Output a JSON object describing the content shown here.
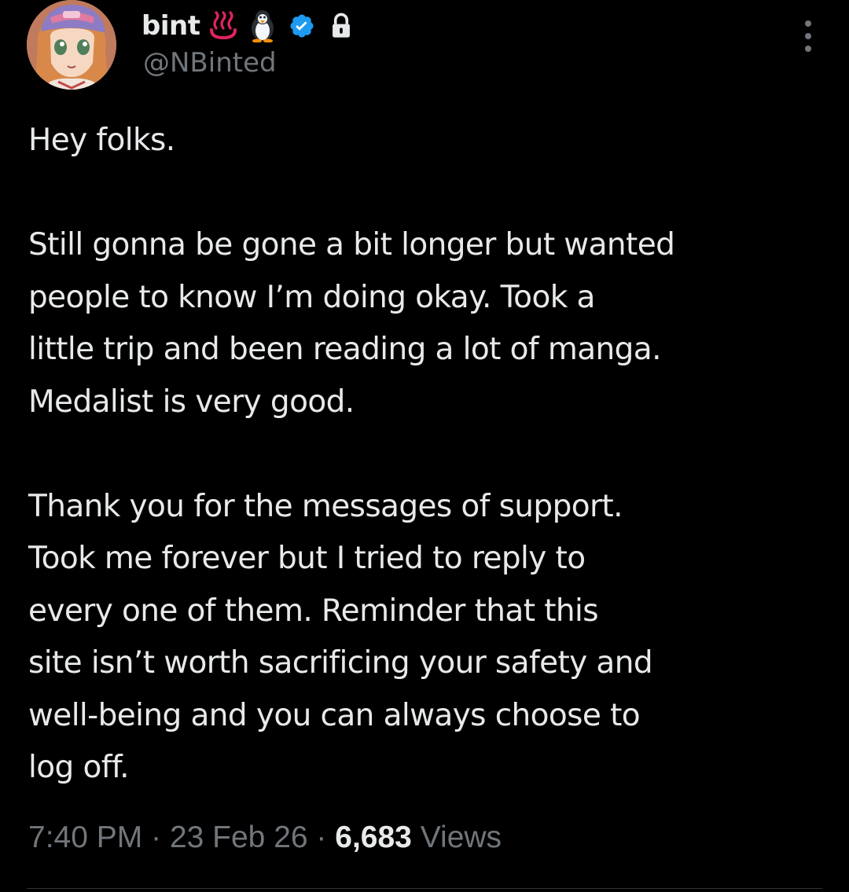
{
  "user": {
    "display_name": "bint",
    "handle": "@NBinted",
    "badges": [
      "hot-springs-icon",
      "penguin-icon",
      "verified-badge-icon",
      "lock-icon"
    ]
  },
  "tweet": {
    "paragraphs": [
      [
        "Hey folks."
      ],
      [
        "Still gonna be gone a bit longer but wanted",
        "people to know I’m doing okay. Took a",
        "little trip and been reading a lot of manga.",
        "Medalist is very good."
      ],
      [
        "Thank you for the messages of support.",
        "Took me forever but I tried to reply to",
        "every one of them. Reminder that this",
        "site isn’t worth sacrificing your safety and",
        "well-being and you can always choose to",
        "log off."
      ]
    ]
  },
  "meta": {
    "time": "7:40 PM",
    "separator": "·",
    "date": "23 Feb 26",
    "views_count": "6,683",
    "views_label": "Views"
  },
  "colors": {
    "background": "#000000",
    "text_primary": "#e7e9ea",
    "text_secondary": "#71767b",
    "verified_blue": "#1d9bf0"
  }
}
